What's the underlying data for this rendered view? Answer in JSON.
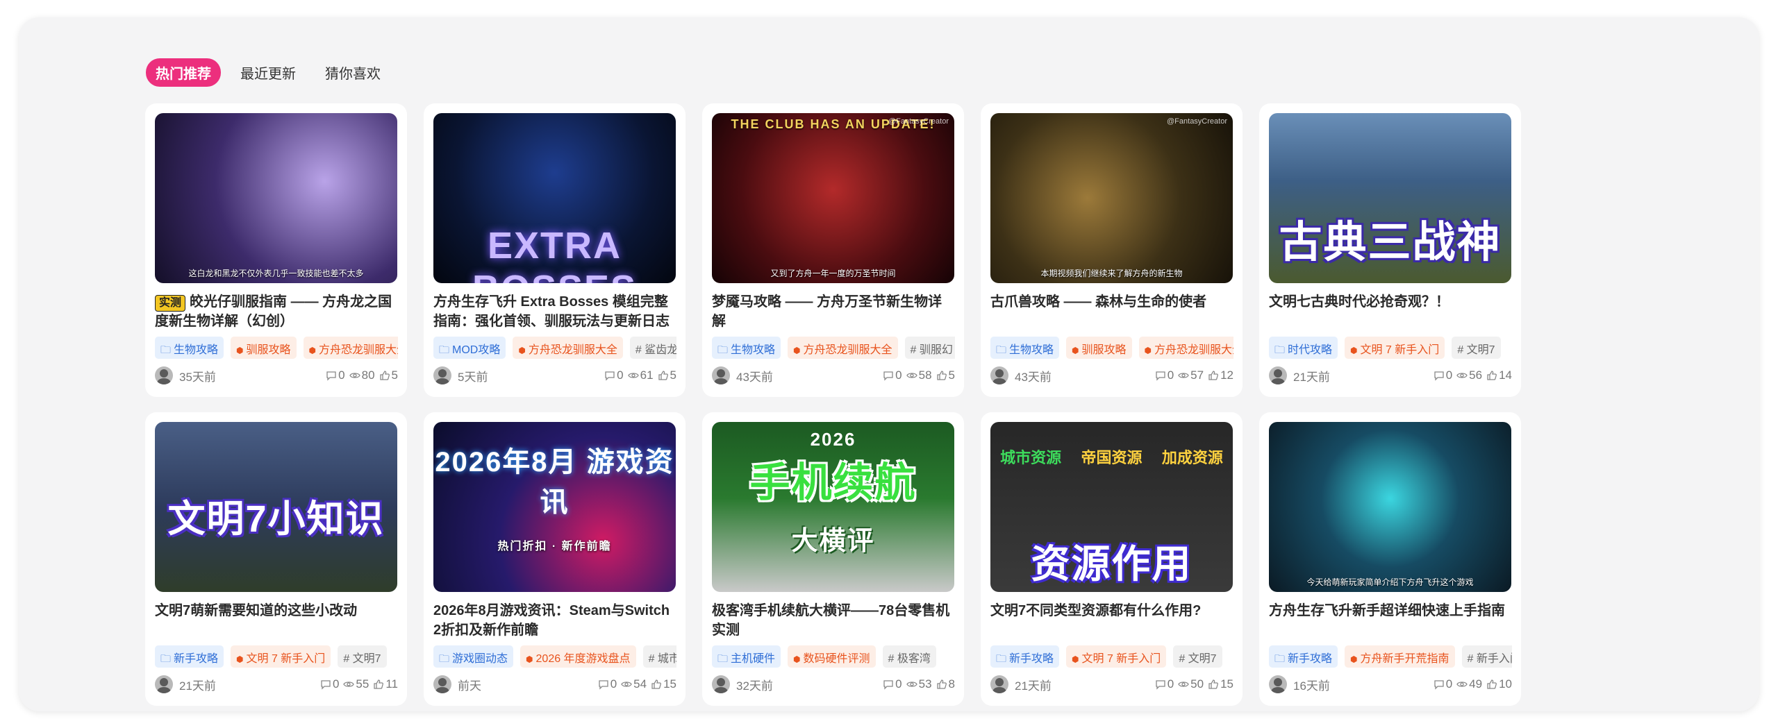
{
  "tabs": [
    {
      "label": "热门推荐",
      "active": true
    },
    {
      "label": "最近更新",
      "active": false
    },
    {
      "label": "猜你喜欢",
      "active": false
    }
  ],
  "colors": {
    "accent": "#ec2f7d",
    "tag_blue": "#2f6ed6",
    "tag_orange": "#e8531d"
  },
  "cards": [
    {
      "badge": "实测",
      "title": "皎光仔驯服指南 —— 方舟龙之国度新生物详解（幻创）",
      "thumb_caption": "这白龙和黑龙不仅外表几乎一致技能也差不太多",
      "thumb_text": "",
      "tags": [
        {
          "label": "生物攻略",
          "icon": "folder-icon"
        },
        {
          "label": "驯服攻略",
          "icon": "cube-icon"
        },
        {
          "label": "方舟恐龙驯服大全",
          "icon": "cube-icon"
        }
      ],
      "time": "35天前",
      "comments": "0",
      "views": "80",
      "likes": "5"
    },
    {
      "badge": "",
      "title": "方舟生存飞升 Extra Bosses 模组完整指南：强化首领、驯服玩法与更新日志",
      "thumb_caption": "",
      "thumb_text": "EXTRA BOSSES",
      "tags": [
        {
          "label": "MOD攻略",
          "icon": "folder-icon"
        },
        {
          "label": "方舟恐龙驯服大全",
          "icon": "cube-icon"
        },
        {
          "label": "# 鲨齿龙",
          "icon": ""
        }
      ],
      "time": "5天前",
      "comments": "0",
      "views": "61",
      "likes": "5"
    },
    {
      "badge": "",
      "title": "梦魇马攻略 —— 方舟万圣节新生物详解",
      "thumb_caption": "又到了方舟一年一度的万圣节时间",
      "thumb_text": "THE CLUB HAS AN UPDATE!",
      "watermark": "@FantasyCreator",
      "tags": [
        {
          "label": "生物攻略",
          "icon": "folder-icon"
        },
        {
          "label": "方舟恐龙驯服大全",
          "icon": "cube-icon"
        },
        {
          "label": "# 驯服幻",
          "icon": ""
        }
      ],
      "time": "43天前",
      "comments": "0",
      "views": "58",
      "likes": "5"
    },
    {
      "badge": "",
      "title": "古爪兽攻略 —— 森林与生命的使者",
      "thumb_caption": "本期视频我们继续来了解方舟的新生物",
      "thumb_text": "",
      "watermark": "@FantasyCreator",
      "tags": [
        {
          "label": "生物攻略",
          "icon": "folder-icon"
        },
        {
          "label": "驯服攻略",
          "icon": "cube-icon"
        },
        {
          "label": "方舟恐龙驯服大全",
          "icon": "cube-icon"
        }
      ],
      "time": "43天前",
      "comments": "0",
      "views": "57",
      "likes": "12"
    },
    {
      "badge": "",
      "title": "文明七古典时代必抢奇观？！",
      "thumb_caption": "",
      "thumb_text": "古典三战神",
      "tags": [
        {
          "label": "时代攻略",
          "icon": "folder-icon"
        },
        {
          "label": "文明 7 新手入门",
          "icon": "cube-icon"
        },
        {
          "label": "# 文明7",
          "icon": ""
        }
      ],
      "time": "21天前",
      "comments": "0",
      "views": "56",
      "likes": "14"
    },
    {
      "badge": "",
      "title": "文明7萌新需要知道的这些小改动",
      "thumb_caption": "",
      "thumb_text": "文明7小知识",
      "tags": [
        {
          "label": "新手攻略",
          "icon": "folder-icon"
        },
        {
          "label": "文明 7 新手入门",
          "icon": "cube-icon"
        },
        {
          "label": "# 文明7",
          "icon": ""
        }
      ],
      "time": "21天前",
      "comments": "0",
      "views": "55",
      "likes": "11"
    },
    {
      "badge": "",
      "title": "2026年8月游戏资讯：Steam与Switch 2折扣及新作前瞻",
      "thumb_caption": "",
      "thumb_text": "2026年8月 游戏资讯",
      "thumb_sub": "热门折扣 · 新作前瞻",
      "tags": [
        {
          "label": "游戏圈动态",
          "icon": "folder-icon"
        },
        {
          "label": "2026 年度游戏盘点",
          "icon": "cube-icon"
        },
        {
          "label": "# 城市",
          "icon": ""
        }
      ],
      "time": "前天",
      "comments": "0",
      "views": "54",
      "likes": "15"
    },
    {
      "badge": "",
      "title": "极客湾手机续航大横评——78台零售机实测",
      "thumb_caption": "",
      "thumb_text": "手机续航",
      "thumb_year": "2026",
      "thumb_sub": "大横评",
      "tags": [
        {
          "label": "主机硬件",
          "icon": "folder-icon"
        },
        {
          "label": "数码硬件评测",
          "icon": "cube-icon"
        },
        {
          "label": "# 极客湾",
          "icon": ""
        }
      ],
      "time": "32天前",
      "comments": "0",
      "views": "53",
      "likes": "8"
    },
    {
      "badge": "",
      "title": "文明7不同类型资源都有什么作用?",
      "thumb_caption": "",
      "thumb_text": "资源作用",
      "thumb_labels": [
        "城市资源",
        "帝国资源",
        "加成资源"
      ],
      "tags": [
        {
          "label": "新手攻略",
          "icon": "folder-icon"
        },
        {
          "label": "文明 7 新手入门",
          "icon": "cube-icon"
        },
        {
          "label": "# 文明7",
          "icon": ""
        }
      ],
      "time": "21天前",
      "comments": "0",
      "views": "50",
      "likes": "15"
    },
    {
      "badge": "",
      "title": "方舟生存飞升新手超详细快速上手指南",
      "thumb_caption": "今天给萌新玩家简单介绍下方舟飞升这个游戏",
      "thumb_text": "",
      "tags": [
        {
          "label": "新手攻略",
          "icon": "folder-icon"
        },
        {
          "label": "方舟新手开荒指南",
          "icon": "cube-icon"
        },
        {
          "label": "# 新手入门",
          "icon": ""
        }
      ],
      "time": "16天前",
      "comments": "0",
      "views": "49",
      "likes": "10"
    }
  ]
}
